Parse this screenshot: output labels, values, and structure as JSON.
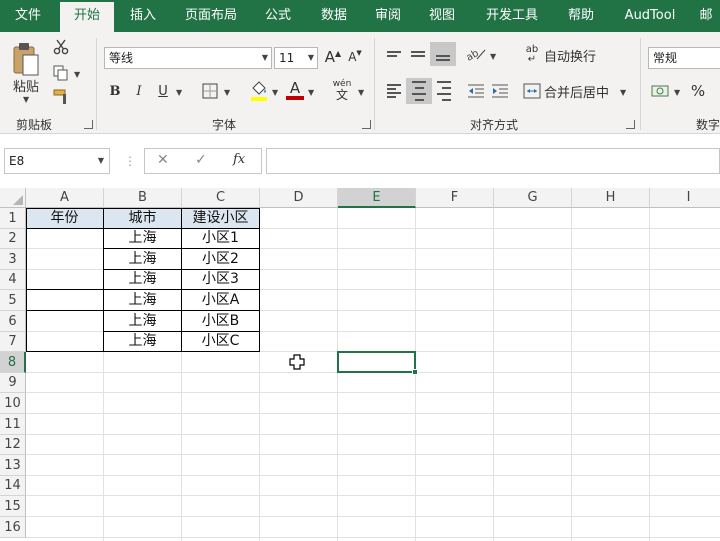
{
  "ribbon_tabs": [
    {
      "label": "文件",
      "active": false
    },
    {
      "label": "开始",
      "active": true
    },
    {
      "label": "插入",
      "active": false
    },
    {
      "label": "页面布局",
      "active": false
    },
    {
      "label": "公式",
      "active": false
    },
    {
      "label": "数据",
      "active": false
    },
    {
      "label": "审阅",
      "active": false
    },
    {
      "label": "视图",
      "active": false
    },
    {
      "label": "开发工具",
      "active": false
    },
    {
      "label": "帮助",
      "active": false
    },
    {
      "label": "AudTool",
      "active": false
    },
    {
      "label": "邮",
      "active": false
    }
  ],
  "clipboard": {
    "paste_label": "粘贴",
    "group_label": "剪贴板"
  },
  "font": {
    "name": "等线",
    "size": "11",
    "increase": "A",
    "decrease": "A",
    "bold": "B",
    "italic": "I",
    "underline": "U",
    "font_color": "A",
    "phonetic": "wén",
    "phonetic_char": "文",
    "group_label": "字体"
  },
  "alignment": {
    "wrap_text": "自动换行",
    "merge_center": "合并后居中",
    "group_label": "对齐方式",
    "wrap_icon": "ab"
  },
  "number": {
    "format": "常规",
    "percent": "%",
    "group_label": "数字"
  },
  "formula_bar": {
    "name_box": "E8",
    "cancel": "✕",
    "enter": "✓",
    "fx": "fx",
    "formula": ""
  },
  "columns": [
    "A",
    "B",
    "C",
    "D",
    "E",
    "F",
    "G",
    "H",
    "I"
  ],
  "selected_column": "E",
  "rows": [
    "1",
    "2",
    "3",
    "4",
    "5",
    "6",
    "7",
    "8",
    "9",
    "10",
    "11",
    "12",
    "13",
    "14",
    "15",
    "16"
  ],
  "selected_row": "8",
  "sheet": {
    "A1": "年份",
    "B1": "城市",
    "C1": "建设小区",
    "B2": "上海",
    "C2": "小区1",
    "B3": "上海",
    "C3": "小区2",
    "B4": "上海",
    "C4": "小区3",
    "B5": "上海",
    "C5": "小区A",
    "B6": "上海",
    "C6": "小区B",
    "B7": "上海",
    "C7": "小区C"
  },
  "colors": {
    "accent": "#217346",
    "header_fill": "#dce6f1",
    "selected_header": "#d2d2d2"
  },
  "icons": [
    "cut-icon",
    "copy-icon",
    "format-painter-icon",
    "border-icon",
    "fill-color-icon",
    "font-color-icon",
    "orientation-icon",
    "indent-icon",
    "cross-cursor-icon"
  ]
}
